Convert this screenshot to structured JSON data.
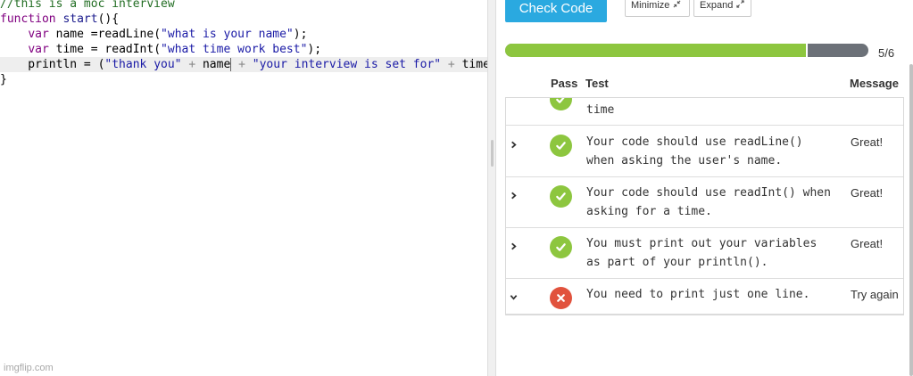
{
  "editor": {
    "lines": [
      {
        "segments": [
          {
            "cls": "comment",
            "text": "//this is a moc interview"
          }
        ]
      },
      {
        "segments": [
          {
            "cls": "kw",
            "text": "function"
          },
          {
            "cls": "",
            "text": " "
          },
          {
            "cls": "fn",
            "text": "start"
          },
          {
            "cls": "",
            "text": "(){"
          }
        ]
      },
      {
        "segments": [
          {
            "cls": "",
            "text": "    "
          },
          {
            "cls": "kw",
            "text": "var"
          },
          {
            "cls": "",
            "text": " name ="
          },
          {
            "cls": "",
            "text": "readLine("
          },
          {
            "cls": "str",
            "text": "\"what is your name\""
          },
          {
            "cls": "",
            "text": ");"
          }
        ]
      },
      {
        "segments": [
          {
            "cls": "",
            "text": "    "
          },
          {
            "cls": "kw",
            "text": "var"
          },
          {
            "cls": "",
            "text": " time = "
          },
          {
            "cls": "",
            "text": "readInt("
          },
          {
            "cls": "str",
            "text": "\"what time work best\""
          },
          {
            "cls": "",
            "text": ");"
          }
        ]
      },
      {
        "segments": [
          {
            "cls": "",
            "text": "    println = ("
          },
          {
            "cls": "str",
            "text": "\"thank you\""
          },
          {
            "cls": "op",
            "text": " + "
          },
          {
            "cls": "",
            "text": "name"
          },
          {
            "cls": "cursor",
            "text": ""
          },
          {
            "cls": "op",
            "text": " + "
          },
          {
            "cls": "str",
            "text": "\"your interview is set for\""
          },
          {
            "cls": "op",
            "text": " + "
          },
          {
            "cls": "",
            "text": "time"
          }
        ],
        "active": true
      },
      {
        "segments": [
          {
            "cls": "",
            "text": "}"
          }
        ]
      }
    ],
    "watermark": "imgflip.com"
  },
  "panel": {
    "check_code_label": "Check Code",
    "minimize_label": "Minimize",
    "expand_label": "Expand",
    "progress": {
      "passed": 5,
      "total": 6,
      "label": "5/6"
    },
    "colors": {
      "accent": "#2aa9e0",
      "pass": "#8dc63f",
      "fail": "#e1523d",
      "track": "#6c7178"
    }
  },
  "table": {
    "headers": {
      "pass": "Pass",
      "test": "Test",
      "message": "Message"
    },
    "rows": [
      {
        "status": "pass",
        "text": "time",
        "message": "",
        "chevron": "",
        "partial": true
      },
      {
        "status": "pass",
        "text": "Your code should use readLine()\nwhen asking the user's name.",
        "message": "Great!",
        "chevron": "right"
      },
      {
        "status": "pass",
        "text": "Your code should use readInt() when\nasking for a time.",
        "message": "Great!",
        "chevron": "right"
      },
      {
        "status": "pass",
        "text": "You must print out your variables\nas part of your println().",
        "message": "Great!",
        "chevron": "right"
      },
      {
        "status": "fail",
        "text": "You need to print just one line.",
        "message": "Try again",
        "chevron": "down"
      }
    ]
  }
}
